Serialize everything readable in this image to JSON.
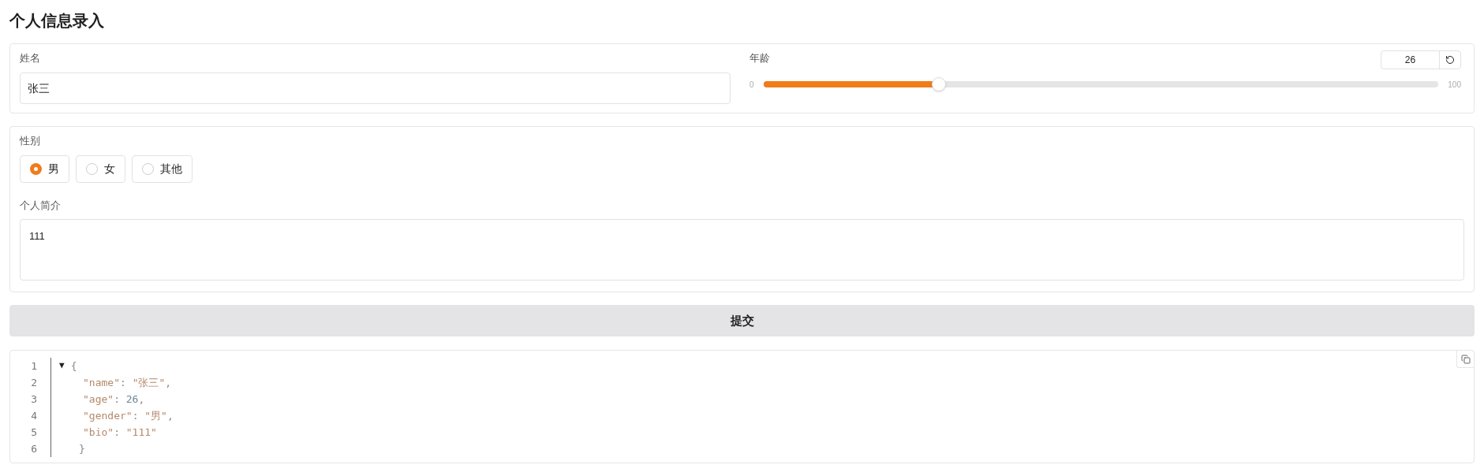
{
  "title": "个人信息录入",
  "name_field": {
    "label": "姓名",
    "value": "张三"
  },
  "age_slider": {
    "label": "年龄",
    "value": "26",
    "min": "0",
    "max": "100",
    "level": 0.26
  },
  "gender": {
    "label": "性别",
    "options": [
      {
        "label": "男",
        "selected": true
      },
      {
        "label": "女",
        "selected": false
      },
      {
        "label": "其他",
        "selected": false
      }
    ]
  },
  "bio_field": {
    "label": "个人简介",
    "value": "111"
  },
  "submit_button": {
    "label": "提交"
  },
  "json_output": {
    "lines": [
      {
        "number": "1",
        "kind": "open",
        "toggle": "▼",
        "tokens": [
          {
            "kind": "punct",
            "text": "{"
          }
        ]
      },
      {
        "number": "2",
        "tokens": [
          {
            "kind": "key",
            "text": "\"name\""
          },
          {
            "kind": "punct",
            "text": ": "
          },
          {
            "kind": "string",
            "text": "\"张三\""
          },
          {
            "kind": "punct",
            "text": ","
          }
        ]
      },
      {
        "number": "3",
        "tokens": [
          {
            "kind": "key",
            "text": "\"age\""
          },
          {
            "kind": "punct",
            "text": ": "
          },
          {
            "kind": "number",
            "text": "26"
          },
          {
            "kind": "punct",
            "text": ","
          }
        ]
      },
      {
        "number": "4",
        "tokens": [
          {
            "kind": "key",
            "text": "\"gender\""
          },
          {
            "kind": "punct",
            "text": ": "
          },
          {
            "kind": "string",
            "text": "\"男\""
          },
          {
            "kind": "punct",
            "text": ","
          }
        ]
      },
      {
        "number": "5",
        "tokens": [
          {
            "kind": "key",
            "text": "\"bio\""
          },
          {
            "kind": "punct",
            "text": ": "
          },
          {
            "kind": "string",
            "text": "\"111\""
          }
        ]
      },
      {
        "number": "6",
        "kind": "close",
        "tokens": [
          {
            "kind": "punct",
            "text": "}"
          }
        ]
      }
    ]
  }
}
